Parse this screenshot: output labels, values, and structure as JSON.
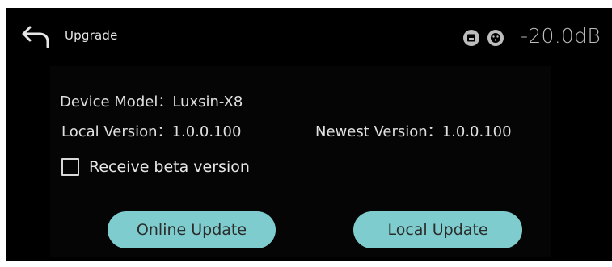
{
  "header": {
    "title": "Upgrade",
    "volume": "-20.0dB",
    "back_icon": "back-arrow-icon",
    "status_icons": [
      "input-card-icon",
      "xlr-connector-icon"
    ]
  },
  "device": {
    "model_label": "Device Model：",
    "model_value": "Luxsin-X8",
    "local_version_label": "Local Version：",
    "local_version_value": "1.0.0.100",
    "newest_version_label": "Newest Version：",
    "newest_version_value": "1.0.0.100"
  },
  "beta": {
    "label": "Receive beta version",
    "checked": false
  },
  "buttons": {
    "online_update": "Online Update",
    "local_update": "Local Update"
  },
  "colors": {
    "background": "#000000",
    "accent": "#7ecccd",
    "text": "#e6e6e6",
    "volume_text": "#bdbdbd"
  }
}
